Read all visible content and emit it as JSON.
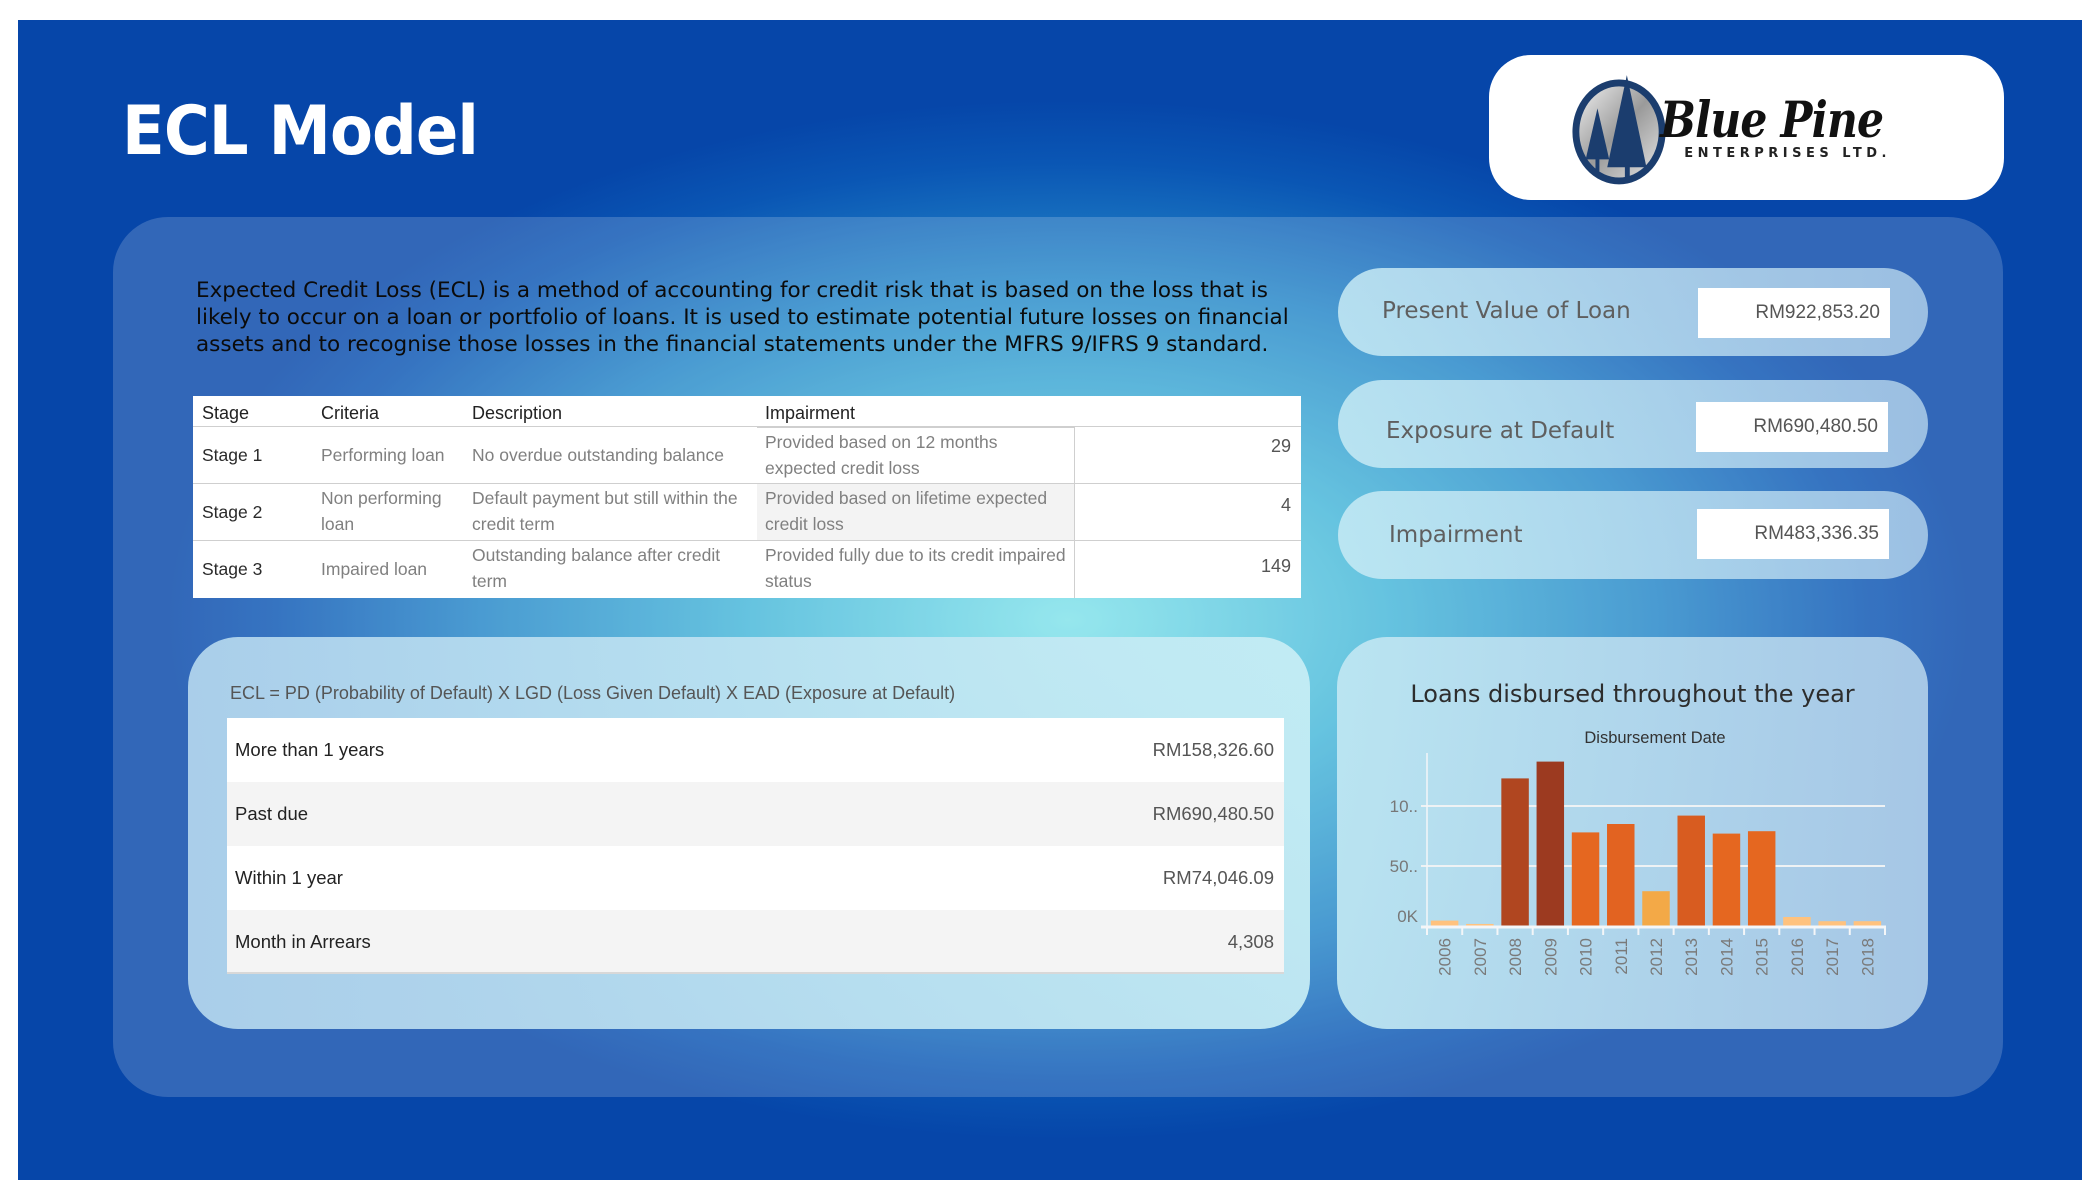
{
  "header": {
    "title": "ECL Model",
    "logo": {
      "name": "Blue Pine",
      "subtitle": "ENTERPRISES LTD.",
      "emblem_icon": "pine-tree-emblem-icon"
    }
  },
  "intro_text": "Expected Credit Loss (ECL) is a method of accounting for credit risk that is based on the loss that is likely to occur on a loan or portfolio of loans. It is used to estimate potential future losses on financial assets and to recognise those losses in the financial statements under the MFRS 9/IFRS 9 standard.",
  "stage_table": {
    "columns": [
      "Stage",
      "Criteria",
      "Description",
      "Impairment"
    ],
    "rows": [
      {
        "stage": "Stage 1",
        "criteria": "Performing loan",
        "description": "No overdue outstanding balance",
        "impairment": "Provided based on 12 months expected credit loss",
        "count": "29"
      },
      {
        "stage": "Stage 2",
        "criteria": "Non performing loan",
        "description": "Default payment but still within the credit term",
        "impairment": "Provided based on lifetime expected credit loss",
        "count": "4"
      },
      {
        "stage": "Stage 3",
        "criteria": "Impaired loan",
        "description": "Outstanding balance after credit term",
        "impairment": "Provided fully due to its credit impaired status",
        "count": "149"
      }
    ]
  },
  "kpis": [
    {
      "label": "Present Value of Loan",
      "value": "RM922,853.20"
    },
    {
      "label": "Exposure at Default",
      "value": "RM690,480.50"
    },
    {
      "label": "Impairment",
      "value": "RM483,336.35"
    }
  ],
  "formula": {
    "text": "ECL = PD (Probability of Default)  X LGD (Loss Given Default)  X EAD (Exposure at Default)",
    "rows": [
      {
        "label": "More than 1 years",
        "value": "RM158,326.60"
      },
      {
        "label": "Past due",
        "value": "RM690,480.50"
      },
      {
        "label": "Within 1 year",
        "value": "RM74,046.09"
      },
      {
        "label": "Month in Arrears",
        "value": "4,308"
      }
    ]
  },
  "chart_data": {
    "type": "bar",
    "title": "Loans disbursed throughout the year",
    "subtitle": "Disbursement Date",
    "xlabel": "",
    "ylabel": "",
    "categories": [
      "2006",
      "2007",
      "2008",
      "2009",
      "2010",
      "2011",
      "2012",
      "2013",
      "2014",
      "2015",
      "2016",
      "2017",
      "2018"
    ],
    "values": [
      4500,
      1700,
      123000,
      137000,
      78000,
      85000,
      29000,
      92000,
      77000,
      79000,
      7500,
      4000,
      4000
    ],
    "colors": [
      "#ffc27e",
      "#ffc27e",
      "#b04620",
      "#9c3a20",
      "#e56720",
      "#e26321",
      "#f3a947",
      "#d85c20",
      "#e56720",
      "#e56720",
      "#ffc27e",
      "#ffc27e",
      "#ffc27e"
    ],
    "yticks": [
      {
        "value": 0,
        "label": "0K"
      },
      {
        "value": 50000,
        "label": "50.."
      },
      {
        "value": 100000,
        "label": "10.."
      }
    ],
    "ylim": [
      0,
      145000
    ],
    "grid": true,
    "legend": "none"
  }
}
